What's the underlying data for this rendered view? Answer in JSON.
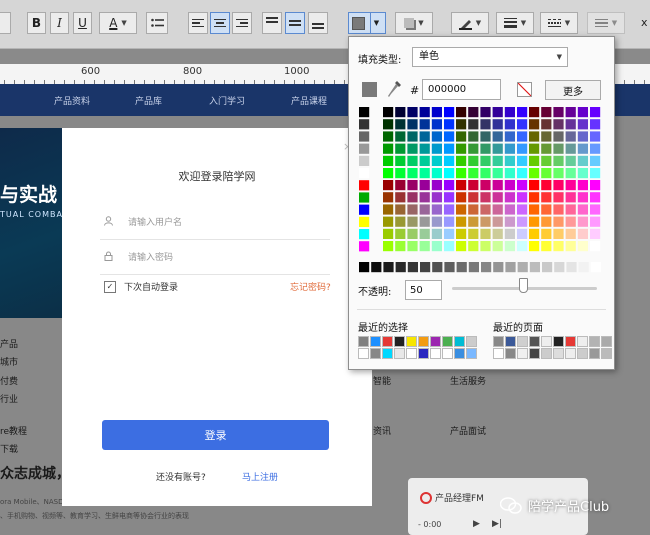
{
  "colors": {
    "toolbar_bg": "#d6d6d6",
    "nav_bg": "#1a3569",
    "login_button": "#3c6ee2",
    "forgot_link": "#e06b3b",
    "current_fill": "#7a7a7a"
  },
  "toolbar": {
    "bold": "B",
    "italic": "I",
    "underline": "U",
    "font_color": "A",
    "close_glyph": "x",
    "icons": [
      "bullet-list-icon",
      "align-left-icon",
      "align-center-icon",
      "align-right-icon",
      "valign-top-icon",
      "valign-middle-icon",
      "valign-bottom-icon",
      "fill-color-icon",
      "shadow-icon",
      "pen-icon",
      "line-weight-icon",
      "line-dash-icon",
      "line-arrow-icon"
    ]
  },
  "ruler": {
    "labels": [
      "600",
      "800",
      "1000"
    ]
  },
  "site": {
    "nav": [
      "产品资料",
      "产品库",
      "入门学习",
      "产品课程"
    ],
    "banner_title": "与实战",
    "banner_subtitle": "TUAL COMBA",
    "side_links": [
      "产品",
      "城市",
      "付费",
      "行业"
    ],
    "mid_links": [
      "智能",
      "生活服务"
    ],
    "lower_links": [
      "re教程",
      "资讯",
      "产品面试"
    ],
    "download": "下载",
    "headline": "众志成城，程",
    "body_snippet": "ora Mobile、NASDAQ:JG）发布《2020年春节移动互联网行业发展趋势的报告》，深度回顾",
    "body_snippet2": "、手机购物、视频等、教育学习、生鲜电商等协会行业的表现",
    "player_title": "产品经理FM",
    "player_time": "- 0:00"
  },
  "login": {
    "title": "欢迎登录陪学网",
    "username_placeholder": "请输入用户名",
    "password_placeholder": "请输入密码",
    "remember_label": "下次自动登录",
    "remember_checked": true,
    "forgot": "忘记密码?",
    "submit": "登录",
    "no_account": "还没有账号?",
    "register": "马上注册"
  },
  "fill_panel": {
    "fill_type_label": "填充类型:",
    "fill_type_value": "单色",
    "hash": "#",
    "hex_value": "000000",
    "more": "更多",
    "opacity_label": "不透明:",
    "opacity_value": "50",
    "recent_selection_label": "最近的选择",
    "recent_page_label": "最近的页面",
    "recent_selection": [
      "#808080",
      "#1e90ff",
      "#e53935",
      "#222222",
      "#f7e600",
      "#f39c12",
      "#9c27b0",
      "#4caf50",
      "#00bcd4",
      "#cccccc",
      "#ffffff",
      "#888888",
      "#00d8ff",
      "#e8e8e8",
      "#ffffff",
      "#2a27c0",
      "#ffffff",
      "#ffffff",
      "#3a8ee0",
      "#7ab8ff"
    ],
    "recent_page": [
      "#888888",
      "#3b5998",
      "#cfcfcf",
      "#555555",
      "#eeeeee",
      "#222222",
      "#e53935",
      "#eeeeee",
      "#b3b3b3",
      "#aaaaaa",
      "#ffffff",
      "#888888",
      "#f0f0f0",
      "#444444",
      "#cccccc",
      "#dddddd",
      "#eeeeee",
      "#cccccc",
      "#999999",
      "#bbbbbb"
    ]
  },
  "watermark": {
    "text": "陪学产品Club"
  }
}
